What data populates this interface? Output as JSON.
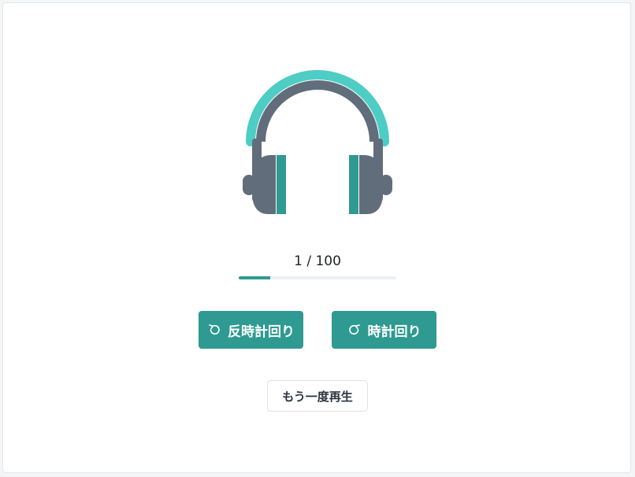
{
  "progress": {
    "current": "1 / 100",
    "fraction": 0.2
  },
  "buttons": {
    "counterclockwise_label": "反時計回り",
    "clockwise_label": "時計回り",
    "replay_label": "もう一度再生"
  },
  "icons": {
    "main": "headphones-icon",
    "counterclockwise": "rotate-ccw-icon",
    "clockwise": "rotate-cw-icon"
  },
  "colors": {
    "accent": "#2e9a92",
    "headband_light": "#4ecdc4",
    "headphone_body": "#626d7c"
  }
}
